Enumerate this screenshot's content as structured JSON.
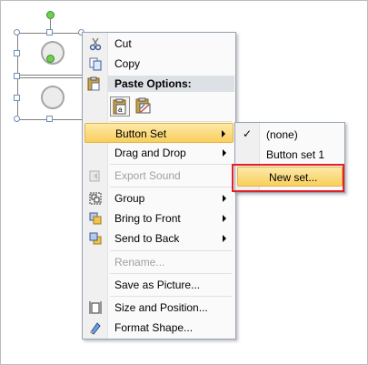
{
  "context_menu": {
    "cut": "Cut",
    "copy": "Copy",
    "paste_options_header": "Paste Options:",
    "button_set": "Button Set",
    "drag_and_drop": "Drag and Drop",
    "export_sound": "Export Sound",
    "group": "Group",
    "bring_to_front": "Bring to Front",
    "send_to_back": "Send to Back",
    "rename": "Rename...",
    "save_as_picture": "Save as Picture...",
    "size_and_position": "Size and Position...",
    "format_shape": "Format Shape..."
  },
  "submenu": {
    "none": "(none)",
    "button_set_1": "Button set 1",
    "new_set": "New set...",
    "checkmark": "✓"
  },
  "colors": {
    "highlight": "#f9cf5d",
    "annotation_red": "#e0202a"
  }
}
